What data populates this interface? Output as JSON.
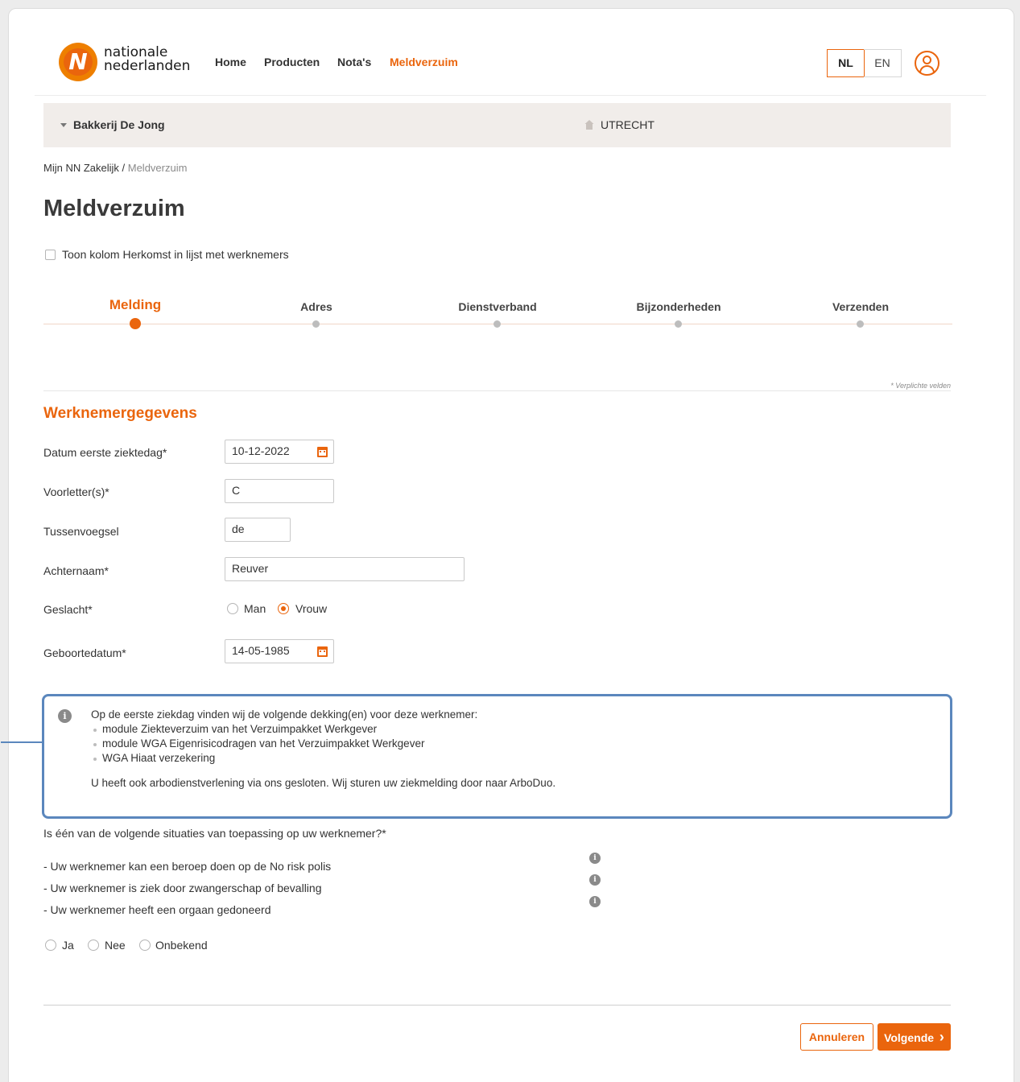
{
  "brand": {
    "name_line1": "nationale",
    "name_line2": "nederlanden",
    "accent": "#ea650d"
  },
  "nav": {
    "items": [
      "Home",
      "Producten",
      "Nota's",
      "Meldverzuim"
    ],
    "active": "Meldverzuim"
  },
  "lang": {
    "nl": "NL",
    "en": "EN",
    "active": "NL"
  },
  "company_bar": {
    "company": "Bakkerij De Jong",
    "city": "UTRECHT"
  },
  "breadcrumb": {
    "root": "Mijn NN Zakelijk",
    "separator": " / ",
    "current": "Meldverzuim"
  },
  "page_title": "Meldverzuim",
  "toggle_column": {
    "label": "Toon kolom Herkomst in lijst met werknemers",
    "checked": false
  },
  "steps": [
    {
      "label": "Melding",
      "active": true
    },
    {
      "label": "Adres",
      "active": false
    },
    {
      "label": "Dienstverband",
      "active": false
    },
    {
      "label": "Bijzonderheden",
      "active": false
    },
    {
      "label": "Verzenden",
      "active": false
    }
  ],
  "required_note": "* Verplichte velden",
  "section_title": "Werknemergegevens",
  "form": {
    "first_sick_day": {
      "label": "Datum eerste ziektedag*",
      "value": "10-12-2022"
    },
    "initials": {
      "label": "Voorletter(s)*",
      "value": "C"
    },
    "infix": {
      "label": "Tussenvoegsel",
      "value": "de"
    },
    "last_name": {
      "label": "Achternaam*",
      "value": "Reuver"
    },
    "gender": {
      "label": "Geslacht*",
      "options": [
        "Man",
        "Vrouw"
      ],
      "selected": "Vrouw"
    },
    "birth_date": {
      "label": "Geboortedatum*",
      "value": "14-05-1985"
    }
  },
  "info": {
    "intro": "Op de eerste ziekdag vinden wij de volgende dekking(en) voor deze werknemer:",
    "items": [
      "module Ziekteverzuim van het Verzuimpakket Werkgever",
      "module WGA Eigenrisicodragen van het Verzuimpakket Werkgever",
      "WGA Hiaat verzekering"
    ],
    "footer": "U heeft ook arbodienstverlening via ons gesloten. Wij sturen uw ziekmelding door naar ArboDuo."
  },
  "situations": {
    "question": "Is één van de volgende situaties van toepassing op uw werknemer?*",
    "items": [
      "- Uw werknemer kan een beroep doen op de No risk polis",
      "- Uw werknemer is ziek door zwangerschap of bevalling",
      "- Uw werknemer heeft een orgaan gedoneerd"
    ],
    "options": [
      "Ja",
      "Nee",
      "Onbekend"
    ]
  },
  "buttons": {
    "cancel": "Annuleren",
    "next": "Volgende",
    "next_chevron": "›"
  }
}
